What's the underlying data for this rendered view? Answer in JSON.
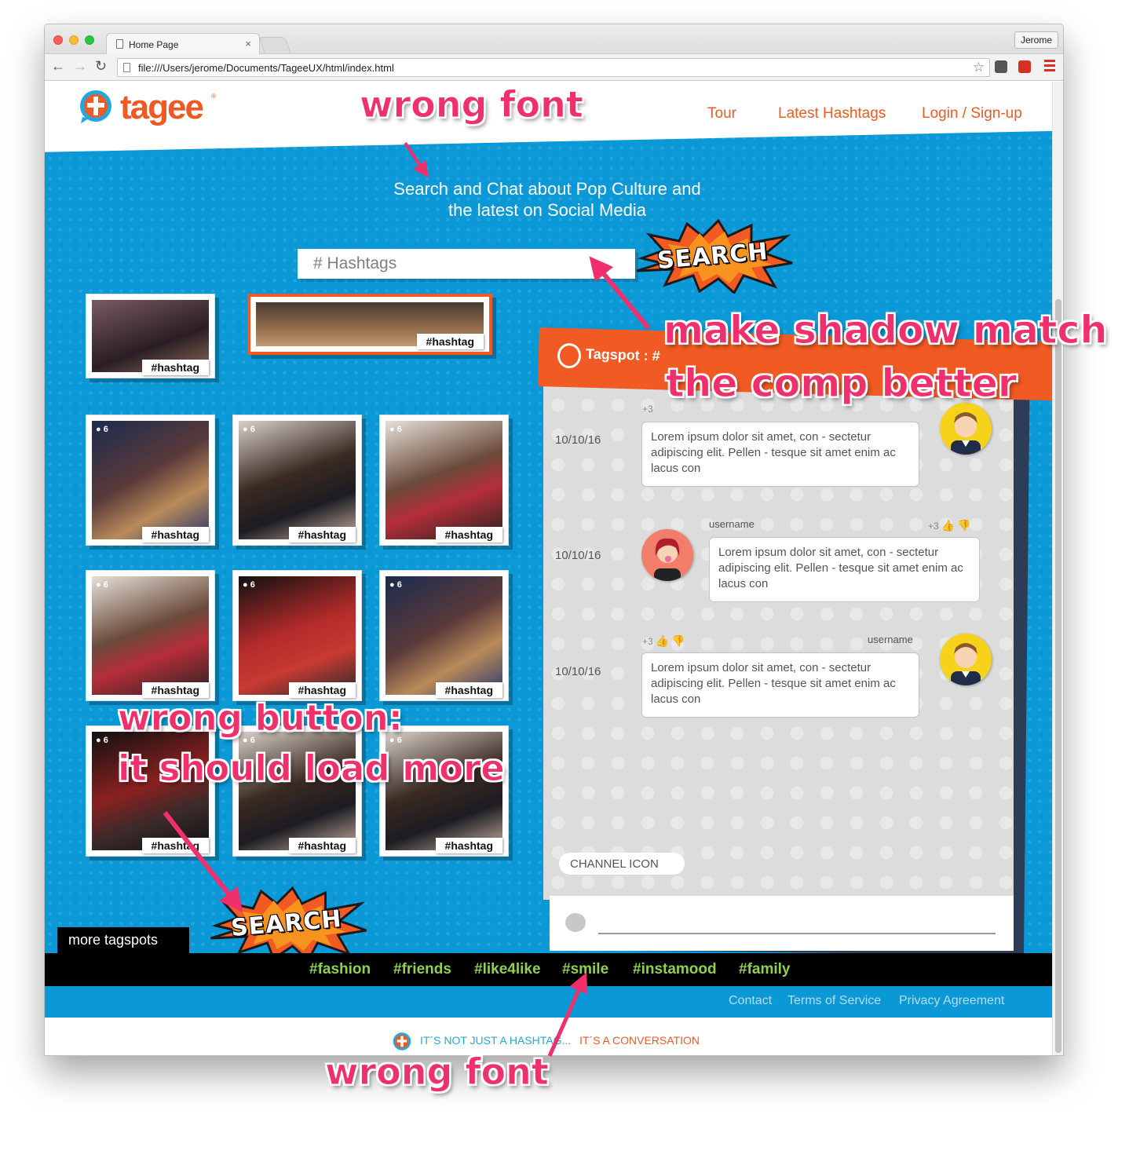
{
  "browser": {
    "tab_title": "Home Page",
    "tab_close": "×",
    "profile_name": "Jerome",
    "url": "file:///Users/jerome/Documents/TageeUX/html/index.html",
    "back_glyph": "←",
    "forward_glyph": "→",
    "reload_glyph": "↻",
    "star_glyph": "☆",
    "extension_icons": [
      "evernote-icon",
      "grammarly-icon"
    ],
    "menu_icon": "hamburger-menu-icon"
  },
  "header": {
    "logo_text": "tagee",
    "logo_mark": "®",
    "nav": [
      "Tour",
      "Latest Hashtags",
      "Login / Sign-up"
    ],
    "accent_color": "#f05a22"
  },
  "hero": {
    "tagline_line1": "Search and Chat about Pop Culture and",
    "tagline_line2": "the latest on Social Media",
    "search_placeholder": "# Hashtags",
    "search_button": "SEARCH",
    "background_color": "#0a98d6"
  },
  "photos": [
    {
      "tag": "#hashtag",
      "count": ""
    },
    {
      "tag": "#hashtag",
      "count": ""
    },
    {
      "tag": "#hashtag",
      "count": "6"
    },
    {
      "tag": "#hashtag",
      "count": "6"
    },
    {
      "tag": "#hashtag",
      "count": "6"
    },
    {
      "tag": "#hashtag",
      "count": "6"
    },
    {
      "tag": "#hashtag",
      "count": "6"
    },
    {
      "tag": "#hashtag",
      "count": "6"
    },
    {
      "tag": "#hashtag",
      "count": "6"
    },
    {
      "tag": "#hashtag",
      "count": "6"
    },
    {
      "tag": "#hashtag",
      "count": "6"
    }
  ],
  "load_more_button": "SEARCH",
  "chat": {
    "title": "Tagspot : #",
    "messages": [
      {
        "date": "10/10/16",
        "username": "",
        "votes": "+3",
        "text": "Lorem ipsum dolor sit amet, con - sectetur adipiscing elit. Pellen - tesque sit amet enim ac lacus con"
      },
      {
        "date": "10/10/16",
        "username": "username",
        "votes": "+3",
        "text": "Lorem ipsum dolor sit amet, con - sectetur adipiscing elit. Pellen - tesque sit amet enim ac lacus con"
      },
      {
        "date": "10/10/16",
        "username": "username",
        "votes": "+3",
        "text": "Lorem ipsum dolor sit amet, con - sectetur adipiscing elit. Pellen - tesque sit amet enim ac lacus con"
      }
    ],
    "channel_icon_label": "CHANNEL ICON",
    "header_color": "#f15a22"
  },
  "more_tagspots": {
    "label": "more tagspots",
    "tags": [
      "#fashion",
      "#friends",
      "#like4like",
      "#smile",
      "#instamood",
      "#family"
    ],
    "tag_color": "#8fd14f"
  },
  "footer": {
    "links": [
      "Contact",
      "Terms of Service",
      "Privacy Agreement"
    ],
    "slogan_part1": "IT´S NOT JUST A HASHTAG...",
    "slogan_part2": "IT´S A CONVERSATION"
  },
  "annotations": {
    "note1": "wrong font",
    "note2": "make shadow match",
    "note3": "the comp better",
    "note4": "wrong button:",
    "note5": "it should load more",
    "note6": "wrong font",
    "color": "#f0306c"
  }
}
